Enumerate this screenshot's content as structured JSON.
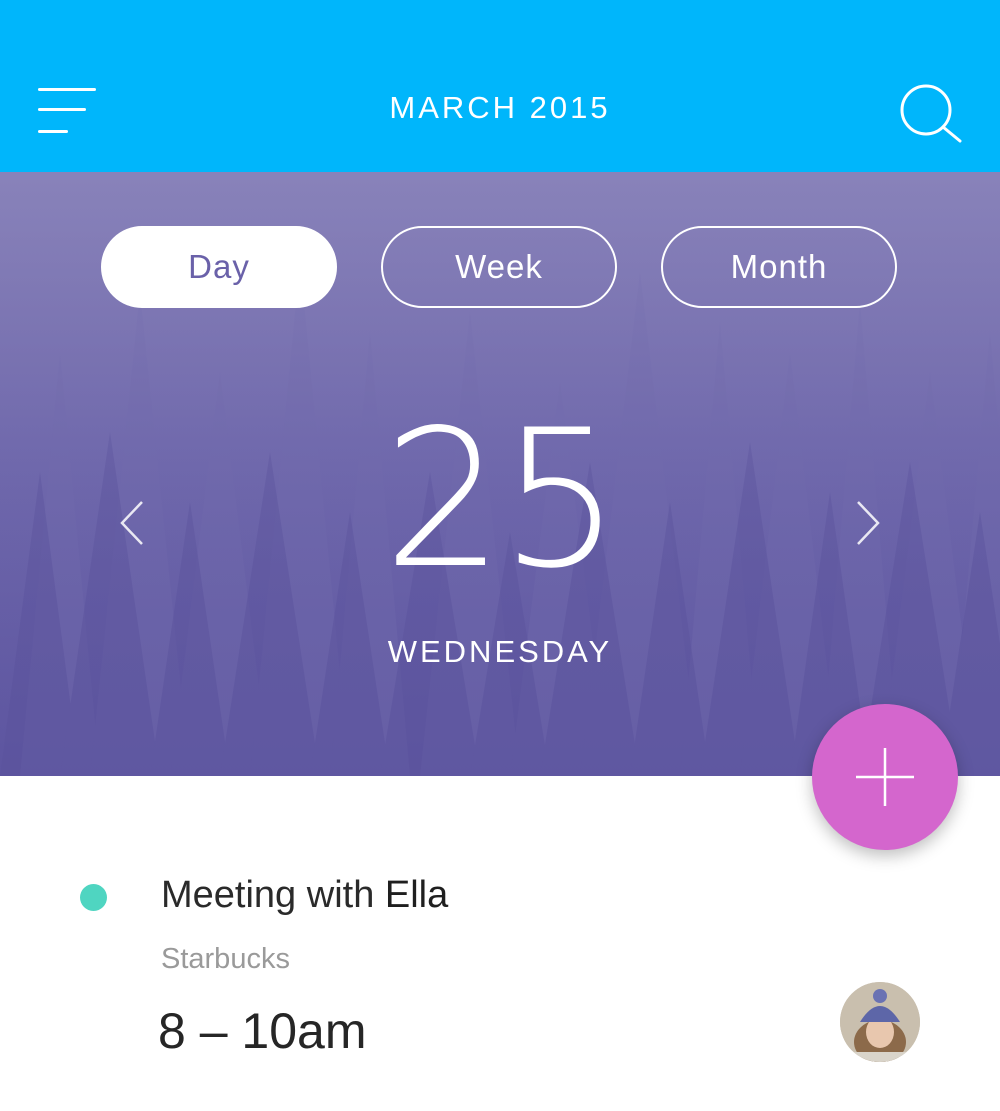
{
  "header": {
    "title": "MARCH 2015",
    "menu_icon": "hamburger-menu-icon",
    "search_icon": "search-icon",
    "background_color": "#00b6fb"
  },
  "view_switcher": {
    "options": [
      "Day",
      "Week",
      "Month"
    ],
    "selected": "Day"
  },
  "date_display": {
    "day_number": "25",
    "weekday": "WEDNESDAY",
    "prev_icon": "chevron-left-icon",
    "next_icon": "chevron-right-icon"
  },
  "fab": {
    "icon": "plus-icon",
    "color": "#d466cd"
  },
  "events": [
    {
      "title_prefix": "Meeting with ",
      "title_person": "Ella",
      "location": "Starbucks",
      "time": "8 – 10am",
      "dot_color": "#4fd5c1",
      "avatar": "avatar-image"
    }
  ]
}
